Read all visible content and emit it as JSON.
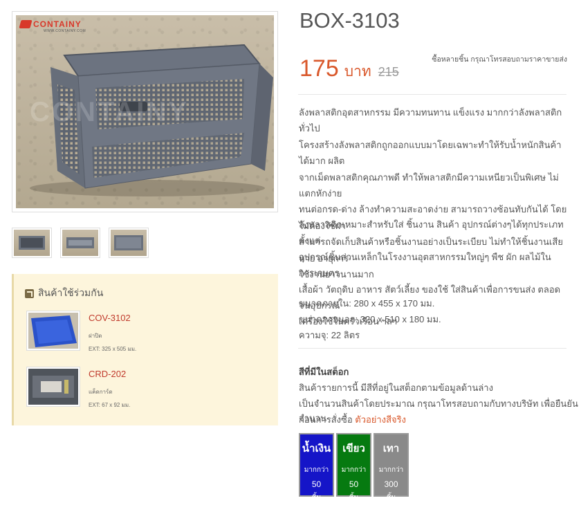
{
  "gallery": {
    "logo_text": "CONTAINY",
    "logo_sub": "WWW.CONTAINY.COM",
    "watermark": "CONTAINY",
    "thumbnails": [
      "thumb-1",
      "thumb-2",
      "thumb-3"
    ]
  },
  "related": {
    "title": "สินค้าใช้ร่วมกัน",
    "items": [
      {
        "code": "COV-3102",
        "desc": "ฝาปิด",
        "ext": "EXT: 325 x 505 มม."
      },
      {
        "code": "CRD-202",
        "desc": "แค็ดการ์ด",
        "ext": "EXT: 67 x 92 มม."
      }
    ]
  },
  "product": {
    "title": "BOX-3103",
    "price": "175",
    "unit": "บาท",
    "old_price": "215",
    "bulk_note": "ซื้อหลายชิ้น กรุณาโทรสอบถามราคาขายส่ง",
    "description_1": [
      "ลังพลาสติกอุตสาหกรรม มีความทนทาน แข็งแรง มากกว่าลังพลาสติกทั่วไป",
      "โครงสร้างลังพลาสติกถูกออกแบบมาโดยเฉพาะทำให้รับน้ำหนักสินค้าได้มาก ผลิต",
      "จากเม็ดพลาสติกคุณภาพดี ทำให้พลาสติกมีความเหนียวเป็นพิเศษ ไม่แตกหักง่าย",
      "ทนต่อกรด-ด่าง ล้างทำความสะอาดง่าย สามารถวางซ้อนทับกันได้ โดยไม่ต้องใช้ฝา",
      "สามารถจัดเก็บสินค้าหรือชิ้นงานอย่างเป็นระเบียบ ไม่ทำให้ชิ้นงานเสียหาย อายุการ",
      "ใช้งานยาวนานมาก"
    ],
    "description_2": [
      "ลังพลาสติกเหมาะสำหรับใส่ ชิ้นงาน สินค้า อุปกรณ์ต่างๆได้ทุกประเภท ตั้งแต่",
      "อุปกรณ์ชิ้นส่วนเหล็กในโรงงานอุตสาหกรรมใหญ่ๆ พืช ผัก ผลไม้ในการเกษตร",
      "เสื้อผ้า วัตถุดิบ อาหาร สัตว์เลี้ยง ของใช้ ใส่สินค้าเพื่อการขนส่ง ตลอดจนอุปกรณ์",
      "เครื่องใช้ในครัวเรือน ฯลฯ"
    ],
    "specs": [
      "ขนาดภายใน: 280 x 455 x 170 มม.",
      "ขนาดภายนอก: 320 x 510 x 180 มม.",
      "ความจุ: 22 ลิตร"
    ]
  },
  "stock": {
    "title": "สีที่มีในสต็อก",
    "line1": "สินค้ารายการนี้ มีสีที่อยู่ในสต็อกตามข้อมูลด้านล่าง",
    "line2": "เป็นจำนวนสินค้าโดยประมาณ กรุณาโทรสอบถามกับทางบริษัท เพื่อยืนยันจำนวน",
    "line3_prefix": "ก่อนการสั่งซื้อ ",
    "line3_link": "ตัวอย่างสีจริง",
    "colors": [
      {
        "name": "น้ำเงิน",
        "more": "มากกว่า",
        "qty": "50",
        "unit": "ชิ้น",
        "bg": "#1515c8"
      },
      {
        "name": "เขียว",
        "more": "มากกว่า",
        "qty": "50",
        "unit": "ชิ้น",
        "bg": "#067a10"
      },
      {
        "name": "เทา",
        "more": "มากกว่า",
        "qty": "300",
        "unit": "ชิ้น",
        "bg": "#8a8a8a"
      }
    ]
  }
}
